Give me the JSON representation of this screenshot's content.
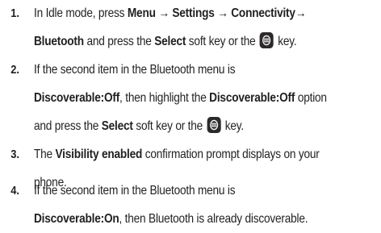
{
  "steps": [
    {
      "number": "1.",
      "line1": [
        "In Idle mode, press ",
        "Menu → Settings → Connectivity→"
      ],
      "line2": [
        "Bluetooth",
        " and press the ",
        "Select",
        " soft key or the ",
        " key."
      ]
    },
    {
      "number": "2.",
      "line1": [
        "If the second item in the Bluetooth menu is"
      ],
      "line2": [
        "Discoverable:Off",
        ", then highlight the ",
        "Discoverable:Off",
        " option"
      ],
      "line3": [
        "and press the ",
        "Select",
        " soft key or the ",
        " key."
      ]
    },
    {
      "number": "3.",
      "line1": [
        "The ",
        "Visibility enabled",
        " confirmation prompt displays on your"
      ],
      "line2": [
        "phone."
      ]
    },
    {
      "number": "4.",
      "line1": [
        "If the second item in the Bluetooth menu is"
      ],
      "line2": [
        "Discoverable:On",
        ", then Bluetooth is already discoverable."
      ]
    }
  ],
  "icons": {
    "select_key": "select-key-icon"
  }
}
